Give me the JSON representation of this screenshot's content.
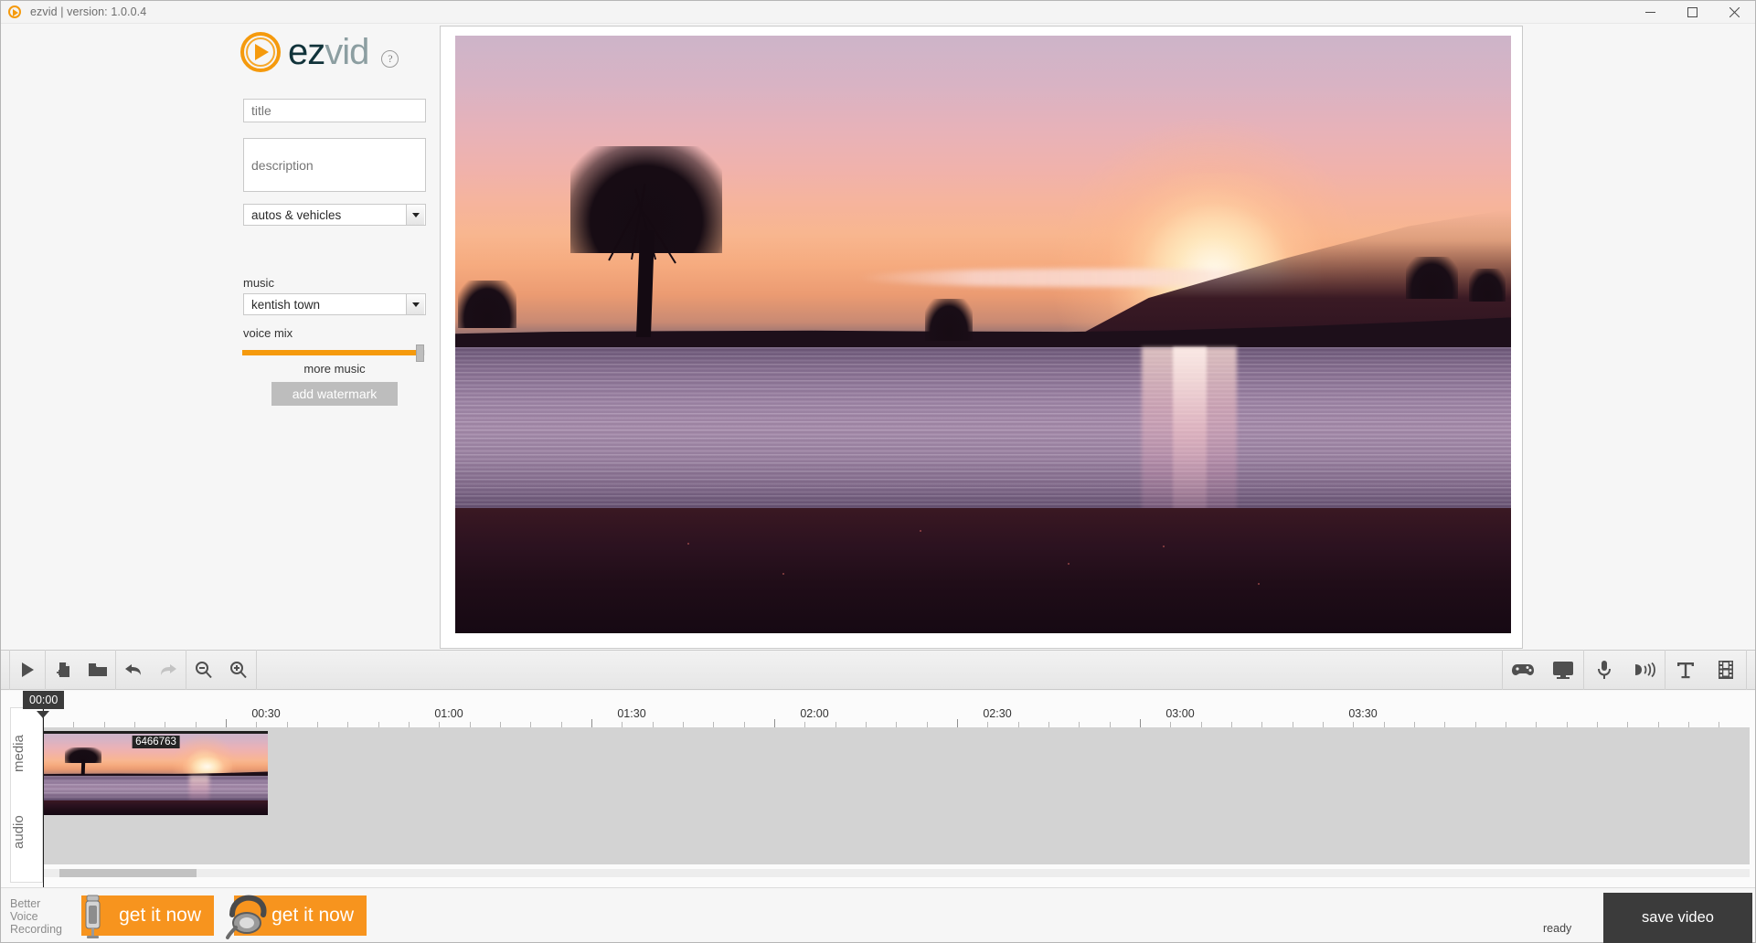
{
  "titlebar": {
    "app_icon": "play-circle-icon",
    "title": "ezvid | version: 1.0.0.4",
    "minimize": "–",
    "maximize": "❐",
    "close": "✕"
  },
  "branding": {
    "logo_part1": "ez",
    "logo_part2": "vid",
    "help_label": "?",
    "accent_color": "#f59a0d"
  },
  "form": {
    "title_placeholder": "title",
    "title_value": "",
    "description_placeholder": "description",
    "description_value": "",
    "category_selected": "autos & vehicles",
    "music_label": "music",
    "music_selected": "kentish town",
    "voice_mix_label": "voice mix",
    "voice_mix_value": 96,
    "more_music_link": "more music",
    "watermark_button": "add watermark"
  },
  "toolbar": {
    "left": [
      {
        "name": "play-icon",
        "label": "play"
      },
      {
        "name": "new-file-icon",
        "label": "new"
      },
      {
        "name": "open-folder-icon",
        "label": "open"
      },
      {
        "name": "undo-icon",
        "label": "undo"
      },
      {
        "name": "redo-icon",
        "label": "redo"
      },
      {
        "name": "zoom-out-icon",
        "label": "zoom out"
      },
      {
        "name": "zoom-in-icon",
        "label": "zoom in"
      }
    ],
    "right": [
      {
        "name": "gamepad-icon",
        "label": "capture game"
      },
      {
        "name": "monitor-icon",
        "label": "capture screen"
      },
      {
        "name": "microphone-icon",
        "label": "record voice"
      },
      {
        "name": "speech-icon",
        "label": "text to speech"
      },
      {
        "name": "text-icon",
        "label": "add text"
      },
      {
        "name": "filmstrip-icon",
        "label": "add slide"
      }
    ]
  },
  "timeline": {
    "playhead_time": "00:00",
    "ruler_labels": [
      "00:30",
      "01:00",
      "01:30",
      "02:00",
      "02:30",
      "03:00",
      "03:30"
    ],
    "tracks": [
      {
        "name": "media",
        "label": "media"
      },
      {
        "name": "audio",
        "label": "audio"
      }
    ],
    "clips": [
      {
        "label": "6466763",
        "track": "media"
      }
    ]
  },
  "bottombar": {
    "promo_label_lines": [
      "Better",
      "Voice",
      "Recording"
    ],
    "promo_buttons": [
      {
        "label": "get it now",
        "icon": "microphone-product-icon"
      },
      {
        "label": "get it now",
        "icon": "headset-product-icon"
      }
    ],
    "status": "ready",
    "save_button": "save video"
  }
}
